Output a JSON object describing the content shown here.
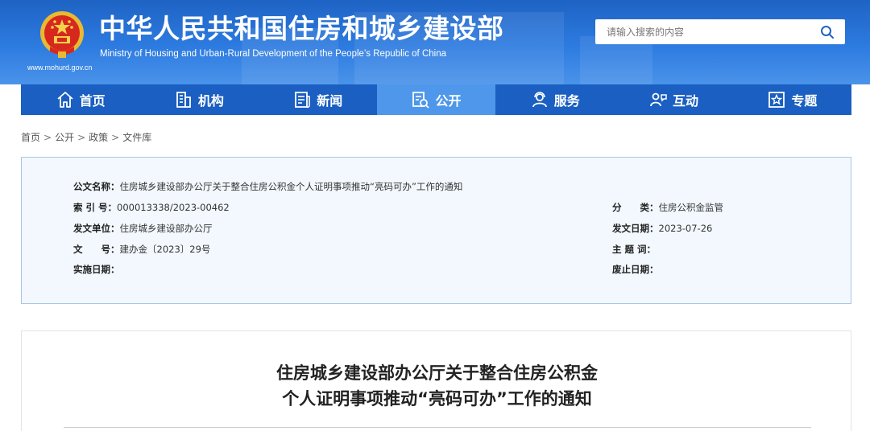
{
  "header": {
    "title_cn": "中华人民共和国住房和城乡建设部",
    "title_en": "Ministry of Housing and Urban-Rural Development of the People’s Republic of China",
    "site_url": "www.mohurd.gov.cn",
    "emblem_icon": "national-emblem-icon",
    "brand_color": "#1e63c4"
  },
  "search": {
    "placeholder": "请输入搜索的内容",
    "value": "",
    "icon": "search-icon"
  },
  "nav": {
    "active_color": "#4e97ea",
    "bar_color": "#1a5fc1",
    "items": [
      {
        "label": "首页",
        "icon": "home-icon",
        "active": false
      },
      {
        "label": "机构",
        "icon": "building-icon",
        "active": false
      },
      {
        "label": "新闻",
        "icon": "newspaper-icon",
        "active": false
      },
      {
        "label": "公开",
        "icon": "document-icon",
        "active": true
      },
      {
        "label": "服务",
        "icon": "service-icon",
        "active": false
      },
      {
        "label": "互动",
        "icon": "interaction-icon",
        "active": false
      },
      {
        "label": "专题",
        "icon": "star-icon",
        "active": false
      }
    ]
  },
  "breadcrumb": [
    "首页",
    "公开",
    "政策",
    "文件库"
  ],
  "meta": {
    "doc_name_label": "公文名称：",
    "doc_name_value": "住房城乡建设部办公厅关于整合住房公积金个人证明事项推动“亮码可办”工作的通知",
    "index_label": "索 引 号：",
    "index_value": "000013338/2023-00462",
    "category_label": "分　　类：",
    "category_value": "住房公积金监管",
    "issuer_label": "发文单位：",
    "issuer_value": "住房城乡建设部办公厅",
    "date_label": "发文日期：",
    "date_value": "2023-07-26",
    "docno_label": "文　　号：",
    "docno_value": "建办金〔2023〕29号",
    "subject_label": "主 题 词：",
    "subject_value": "",
    "effective_label": "实施日期：",
    "effective_value": "",
    "expiry_label": "废止日期：",
    "expiry_value": ""
  },
  "article": {
    "title_line1": "住房城乡建设部办公厅关于整合住房公积金",
    "title_line2": "个人证明事项推动“亮码可办”工作的通知"
  }
}
